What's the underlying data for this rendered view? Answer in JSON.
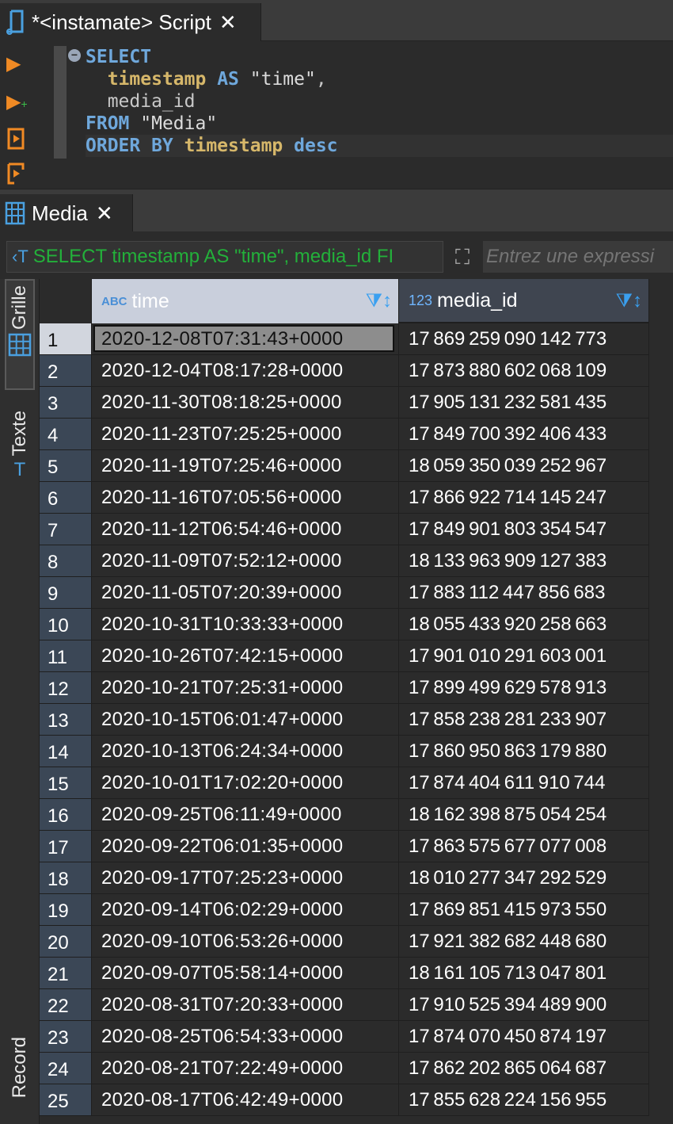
{
  "script_tab": {
    "title": "*<instamate> Script",
    "close": "✕"
  },
  "editor": {
    "fold_marker": "−",
    "lines": [
      {
        "parts": [
          {
            "t": "kw",
            "v": "SELECT"
          }
        ]
      },
      {
        "parts": [
          {
            "t": "plain",
            "v": "  "
          },
          {
            "t": "ident",
            "v": "timestamp"
          },
          {
            "t": "plain",
            "v": " "
          },
          {
            "t": "kw",
            "v": "AS"
          },
          {
            "t": "plain",
            "v": " "
          },
          {
            "t": "str",
            "v": "\"time\""
          },
          {
            "t": "plain",
            "v": ","
          }
        ]
      },
      {
        "parts": [
          {
            "t": "plain",
            "v": "  media_id"
          }
        ]
      },
      {
        "parts": [
          {
            "t": "kw",
            "v": "FROM"
          },
          {
            "t": "plain",
            "v": " "
          },
          {
            "t": "str",
            "v": "\"Media\""
          }
        ]
      },
      {
        "parts": [
          {
            "t": "kw",
            "v": "ORDER BY"
          },
          {
            "t": "plain",
            "v": " "
          },
          {
            "t": "ident",
            "v": "timestamp"
          },
          {
            "t": "plain",
            "v": " "
          },
          {
            "t": "kw",
            "v": "desc"
          }
        ]
      }
    ]
  },
  "results_tab": {
    "title": "Media",
    "close": "✕"
  },
  "filter": {
    "query_text": "SELECT timestamp AS \"time\", media_id FI",
    "placeholder": "Entrez une expressi"
  },
  "side_tabs": {
    "grille": "Grille",
    "texte": "Texte",
    "record": "Record"
  },
  "grid": {
    "columns": [
      {
        "type_badge": "ABC",
        "label": "time"
      },
      {
        "type_badge": "123",
        "label": "media_id"
      }
    ],
    "selected_row": 1,
    "rows": [
      {
        "n": "1",
        "time": "2020-12-08T07:31:43+0000",
        "id": "17 869 259 090 142 773"
      },
      {
        "n": "2",
        "time": "2020-12-04T08:17:28+0000",
        "id": "17 873 880 602 068 109"
      },
      {
        "n": "3",
        "time": "2020-11-30T08:18:25+0000",
        "id": "17 905 131 232 581 435"
      },
      {
        "n": "4",
        "time": "2020-11-23T07:25:25+0000",
        "id": "17 849 700 392 406 433"
      },
      {
        "n": "5",
        "time": "2020-11-19T07:25:46+0000",
        "id": "18 059 350 039 252 967"
      },
      {
        "n": "6",
        "time": "2020-11-16T07:05:56+0000",
        "id": "17 866 922 714 145 247"
      },
      {
        "n": "7",
        "time": "2020-11-12T06:54:46+0000",
        "id": "17 849 901 803 354 547"
      },
      {
        "n": "8",
        "time": "2020-11-09T07:52:12+0000",
        "id": "18 133 963 909 127 383"
      },
      {
        "n": "9",
        "time": "2020-11-05T07:20:39+0000",
        "id": "17 883 112 447 856 683"
      },
      {
        "n": "10",
        "time": "2020-10-31T10:33:33+0000",
        "id": "18 055 433 920 258 663"
      },
      {
        "n": "11",
        "time": "2020-10-26T07:42:15+0000",
        "id": "17 901 010 291 603 001"
      },
      {
        "n": "12",
        "time": "2020-10-21T07:25:31+0000",
        "id": "17 899 499 629 578 913"
      },
      {
        "n": "13",
        "time": "2020-10-15T06:01:47+0000",
        "id": "17 858 238 281 233 907"
      },
      {
        "n": "14",
        "time": "2020-10-13T06:24:34+0000",
        "id": "17 860 950 863 179 880"
      },
      {
        "n": "15",
        "time": "2020-10-01T17:02:20+0000",
        "id": "17 874 404 611 910 744"
      },
      {
        "n": "16",
        "time": "2020-09-25T06:11:49+0000",
        "id": "18 162 398 875 054 254"
      },
      {
        "n": "17",
        "time": "2020-09-22T06:01:35+0000",
        "id": "17 863 575 677 077 008"
      },
      {
        "n": "18",
        "time": "2020-09-17T07:25:23+0000",
        "id": "18 010 277 347 292 529"
      },
      {
        "n": "19",
        "time": "2020-09-14T06:02:29+0000",
        "id": "17 869 851 415 973 550"
      },
      {
        "n": "20",
        "time": "2020-09-10T06:53:26+0000",
        "id": "17 921 382 682 448 680"
      },
      {
        "n": "21",
        "time": "2020-09-07T05:58:14+0000",
        "id": "18 161 105 713 047 801"
      },
      {
        "n": "22",
        "time": "2020-08-31T07:20:33+0000",
        "id": "17 910 525 394 489 900"
      },
      {
        "n": "23",
        "time": "2020-08-25T06:54:33+0000",
        "id": "17 874 070 450 874 197"
      },
      {
        "n": "24",
        "time": "2020-08-21T07:22:49+0000",
        "id": "17 862 202 865 064 687"
      },
      {
        "n": "25",
        "time": "2020-08-17T06:42:49+0000",
        "id": "17 855 628 224 156 955"
      }
    ]
  }
}
